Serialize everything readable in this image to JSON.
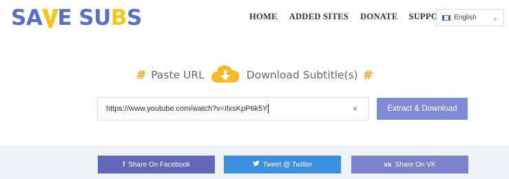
{
  "logo": {
    "part1": "SA",
    "part2": "E SU",
    "part3": "B",
    "part4": "S",
    "full": "SAVESUBS"
  },
  "nav": {
    "items": [
      "HOME",
      "ADDED SITES",
      "DONATE",
      "SUPPORT"
    ]
  },
  "language": {
    "selected": "English",
    "icon": "flag-icon"
  },
  "headline": {
    "hash_left": "#",
    "text1": "Paste URL",
    "text2": "Download Subtitle(s)",
    "hash_right": "#",
    "icon": "cloud-download-icon"
  },
  "search": {
    "value": "https://www.youtube.com/watch?v=IlxsKpP6k5Y",
    "clear_symbol": "×",
    "button_label": "Extract & Download"
  },
  "share": {
    "facebook": {
      "icon": "f",
      "label": "Share On Facebook"
    },
    "twitter": {
      "icon": "🐦",
      "label": "Tweet @ Twitter"
    },
    "vk": {
      "icon": "ᴠᴋ",
      "label": "Share On VK"
    }
  },
  "colors": {
    "brand_blue": "#5a6fbf",
    "brand_yellow": "#f5c518",
    "accent_orange": "#f5a623",
    "button": "#7f8bd4",
    "facebook": "#6268b7",
    "twitter": "#3d8fe0",
    "vk": "#7c82c9"
  }
}
